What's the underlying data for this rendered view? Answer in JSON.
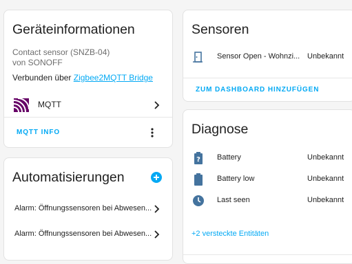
{
  "device_info": {
    "title": "Geräteinformationen",
    "model": "Contact sensor (SNZB-04)",
    "manufacturer": "von SONOFF",
    "connected_prefix": "Verbunden über ",
    "connected_link": "Zigbee2MQTT Bridge",
    "integration_label": "MQTT",
    "action_label": "MQTT INFO"
  },
  "automations": {
    "title": "Automatisierungen",
    "items": [
      {
        "label": "Alarm: Öffnungssensoren bei Abwesen..."
      },
      {
        "label": "Alarm: Öffnungssensoren bei Abwesen..."
      }
    ]
  },
  "sensors": {
    "title": "Sensoren",
    "entities": [
      {
        "name": "Sensor Open - Wohnzi...",
        "state": "Unbekannt",
        "icon": "door-icon"
      }
    ],
    "action_label": "ZUM DASHBOARD HINZUFÜGEN"
  },
  "diagnostics": {
    "title": "Diagnose",
    "entities": [
      {
        "name": "Battery",
        "state": "Unbekannt",
        "icon": "battery-unknown-icon"
      },
      {
        "name": "Battery low",
        "state": "Unbekannt",
        "icon": "battery-icon"
      },
      {
        "name": "Last seen",
        "state": "Unbekannt",
        "icon": "clock-icon"
      }
    ],
    "hidden_link": "+2 versteckte Entitäten"
  },
  "colors": {
    "accent": "#03a9f4",
    "icon": "#44739e",
    "mqtt_brand": "#660066",
    "background": "#f5f5f5"
  }
}
